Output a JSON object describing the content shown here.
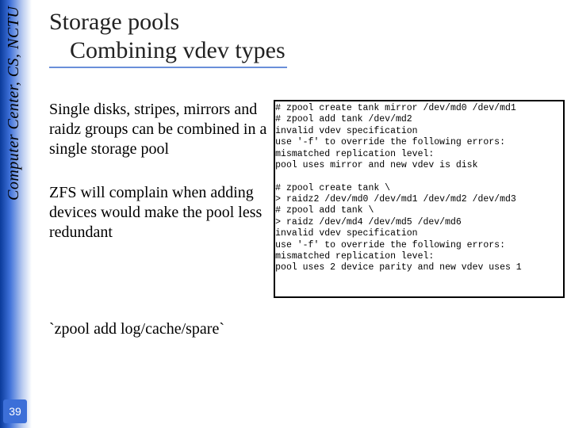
{
  "sidebar": {
    "vertical_label": "Computer Center, CS, NCTU",
    "page_number": "39"
  },
  "title": {
    "main": "Storage pools",
    "sub": "Combining vdev types"
  },
  "body": {
    "para1": "Single disks, stripes, mirrors and raidz groups can be combined in a single storage pool",
    "para2": "ZFS will complain when adding devices would make the pool less redundant",
    "footnote": "`zpool add log/cache/spare`"
  },
  "terminal": {
    "text": "# zpool create tank mirror /dev/md0 /dev/md1\n# zpool add tank /dev/md2\ninvalid vdev specification\nuse '-f' to override the following errors:\nmismatched replication level:\npool uses mirror and new vdev is disk\n\n# zpool create tank \\\n> raidz2 /dev/md0 /dev/md1 /dev/md2 /dev/md3\n# zpool add tank \\\n> raidz /dev/md4 /dev/md5 /dev/md6\ninvalid vdev specification\nuse '-f' to override the following errors:\nmismatched replication level:\npool uses 2 device parity and new vdev uses 1"
  }
}
